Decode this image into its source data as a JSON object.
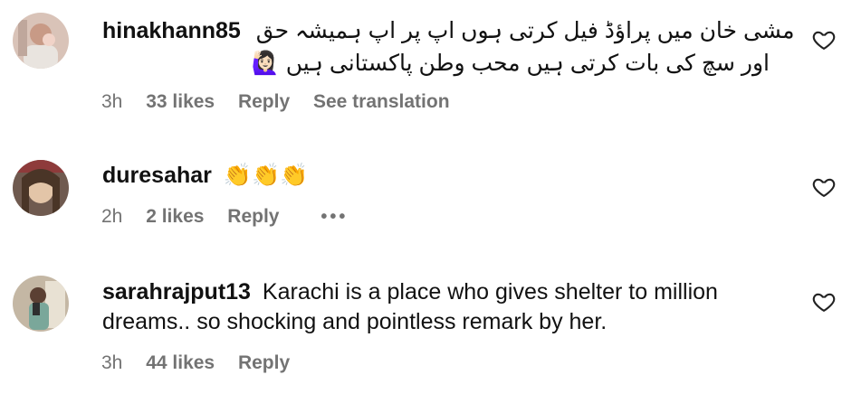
{
  "comments": [
    {
      "username": "hinakhann85",
      "text_line1": "مشی خان میں پراؤڈ فیل کرتی ہوں اپ پر اپ ہمیشہ حق",
      "text_line2": "اور سچ کی بات کرتی ہیں محب وطن پاکستانی ہیں 🙋🏻‍♀️",
      "time": "3h",
      "likes": "33 likes",
      "reply": "Reply",
      "translate": "See translation",
      "avatar_icon": "avatar-hinakhann85"
    },
    {
      "username": "duresahar",
      "text": "👏👏👏",
      "time": "2h",
      "likes": "2 likes",
      "reply": "Reply",
      "more": "•••",
      "avatar_icon": "avatar-duresahar"
    },
    {
      "username": "sarahrajput13",
      "text_line1": "Karachi is a place who gives shelter to million",
      "text_line2": "dreams.. so shocking and pointless remark by her.",
      "time": "3h",
      "likes": "44 likes",
      "reply": "Reply",
      "avatar_icon": "avatar-sarahrajput13"
    }
  ],
  "icons": {
    "like": "heart-outline-icon",
    "more": "more-options-icon"
  },
  "colors": {
    "text": "#111111",
    "secondary": "#737373",
    "background": "#ffffff"
  }
}
